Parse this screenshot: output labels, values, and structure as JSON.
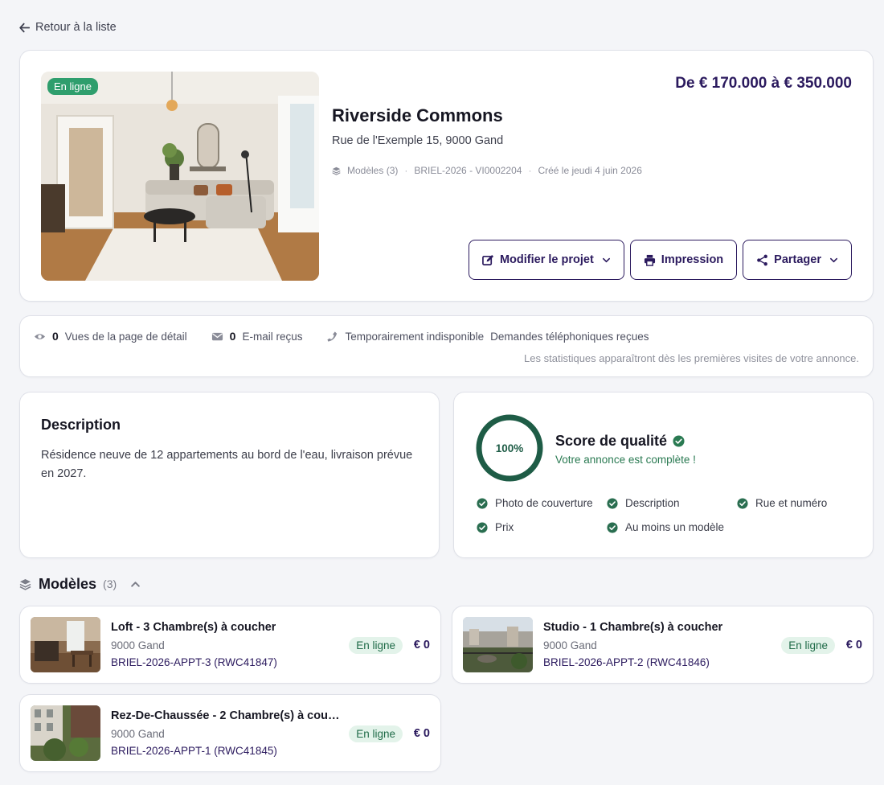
{
  "back_link": "Retour à la liste",
  "project": {
    "status": "En ligne",
    "price": "De € 170.000 à € 350.000",
    "title": "Riverside Commons",
    "address": "Rue de l'Exemple 15, 9000 Gand",
    "meta": {
      "models": "Modèles (3)",
      "reference": "BRIEL-2026 - VI0002204",
      "created": "Créé le jeudi 4 juin 2026"
    },
    "actions": {
      "edit": "Modifier le projet",
      "print": "Impression",
      "share": "Partager"
    }
  },
  "stats": {
    "views_count": "0",
    "views_label": "Vues de la page de détail",
    "emails_count": "0",
    "emails_label": "E-mail reçus",
    "phone_status": "Temporairement indisponible",
    "phone_label": "Demandes téléphoniques reçues",
    "note": "Les statistiques apparaîtront dès les premières visites de votre annonce."
  },
  "description": {
    "title": "Description",
    "text": "Résidence neuve de 12 appartements au bord de l'eau, livraison prévue en 2027."
  },
  "quality": {
    "score_text": "100%",
    "score_fraction": 1.0,
    "title": "Score de qualité",
    "subtitle": "Votre annonce est complète !",
    "criteria": [
      "Photo de couverture",
      "Description",
      "Rue et numéro",
      "Prix",
      "Au moins un modèle"
    ]
  },
  "models": {
    "title": "Modèles",
    "count": "(3)",
    "items": [
      {
        "name": "Loft - 3 Chambre(s) à coucher",
        "city": "9000 Gand",
        "ref": "BRIEL-2026-APPT-3 (RWC41847)",
        "status": "En ligne",
        "price": "€ 0"
      },
      {
        "name": "Studio - 1 Chambre(s) à coucher",
        "city": "9000 Gand",
        "ref": "BRIEL-2026-APPT-2 (RWC41846)",
        "status": "En ligne",
        "price": "€ 0"
      },
      {
        "name": "Rez-De-Chaussée - 2 Chambre(s) à couch...",
        "city": "9000 Gand",
        "ref": "BRIEL-2026-APPT-1 (RWC41845)",
        "status": "En ligne",
        "price": "€ 0"
      }
    ]
  },
  "colors": {
    "brand": "#2b1a5e",
    "success": "#2f9e6d",
    "success_dark": "#1e5c46",
    "badge_bg": "#e3f3ea"
  },
  "icons": {
    "back": "arrow-left-icon",
    "models": "layers-icon",
    "edit": "edit-icon",
    "print": "printer-icon",
    "share": "share-icon",
    "views": "eye-icon",
    "emails": "envelope-icon",
    "phone": "phone-icon",
    "check": "check-circle-icon"
  }
}
